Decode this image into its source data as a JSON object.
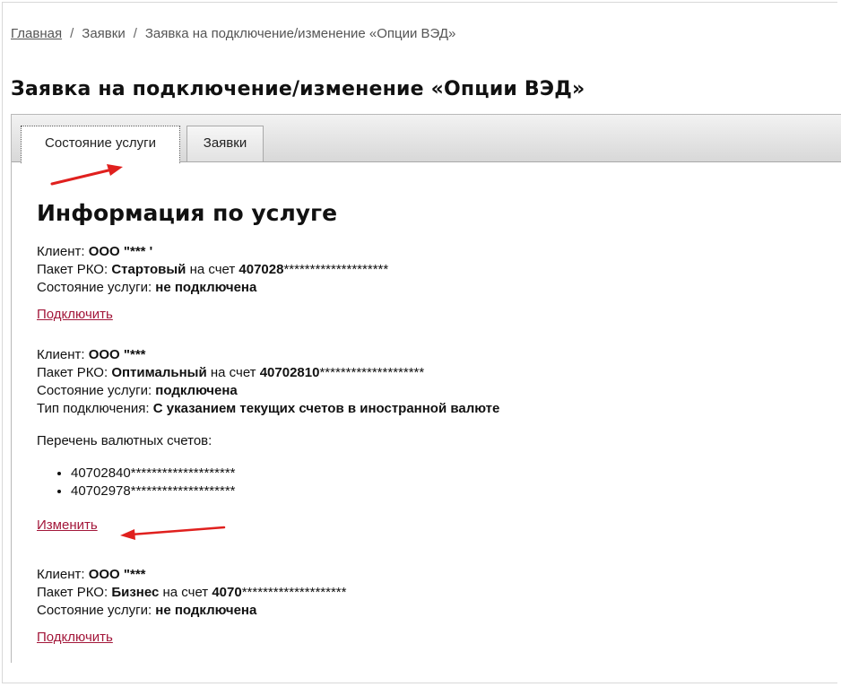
{
  "breadcrumb": {
    "home": "Главная",
    "sep1": "/",
    "requests": "Заявки",
    "sep2": "/",
    "current": "Заявка на подключение/изменение «Опции ВЭД»"
  },
  "page_title": "Заявка на подключение/изменение «Опции ВЭД»",
  "tabs": [
    {
      "label": "Состояние услуги",
      "active": true
    },
    {
      "label": "Заявки",
      "active": false
    }
  ],
  "section_title": "Информация по услуге",
  "labels": {
    "client": "Клиент:",
    "package": "Пакет РКО:",
    "on_account": "на счет",
    "state": "Состояние услуги:",
    "conn_type": "Тип подключения:",
    "currency_list": "Перечень валютных счетов:"
  },
  "services": [
    {
      "client": "ООО \"*** '",
      "package": "Стартовый",
      "account_prefix": "407028",
      "account_mask": "********************",
      "state": "не подключена",
      "action": "Подключить"
    },
    {
      "client": "ООО \"***",
      "package": "Оптимальный",
      "account_prefix": "40702810",
      "account_mask": "********************",
      "state": "подключена",
      "conn_type": "С указанием текущих счетов в иностранной валюте",
      "currency_accounts": [
        {
          "prefix": "40702840",
          "mask": "********************"
        },
        {
          "prefix": "40702978",
          "mask": "********************"
        }
      ],
      "action": "Изменить"
    },
    {
      "client": "ООО \"***",
      "package": "Бизнес",
      "account_prefix": "4070",
      "account_mask": "********************",
      "state": "не подключена",
      "action": "Подключить"
    }
  ],
  "colors": {
    "link": "#a3173a",
    "annotation_arrow": "#e0201e"
  }
}
